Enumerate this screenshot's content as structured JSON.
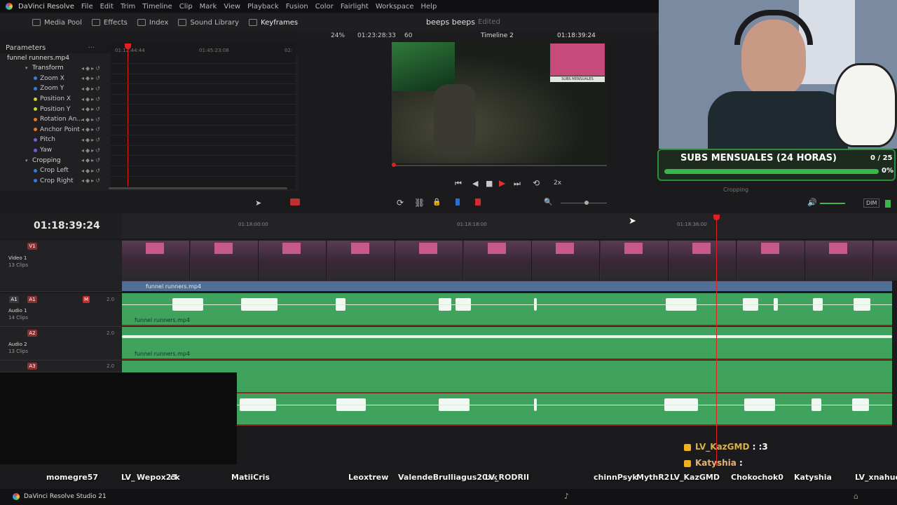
{
  "app": {
    "name": "DaVinci Resolve",
    "menu": [
      "File",
      "Edit",
      "Trim",
      "Timeline",
      "Clip",
      "Mark",
      "View",
      "Playback",
      "Fusion",
      "Color",
      "Fairlight",
      "Workspace",
      "Help"
    ]
  },
  "toolbar": {
    "media_pool": "Media Pool",
    "effects": "Effects",
    "index": "Index",
    "sound_library": "Sound Library",
    "keyframes": "Keyframes",
    "project_title": "beeps beeps",
    "edited": "Edited"
  },
  "viewer": {
    "zoom": "24%",
    "source_timecode": "01:23:28:33",
    "fps": "60",
    "timeline_name": "Timeline 2",
    "record_timecode": "01:18:39:24",
    "speed": "2x"
  },
  "inspector": {
    "header": "Parameters",
    "clip_name": "funnel runners.mp4",
    "ruler_left": "01:12:44:44",
    "ruler_mid": "01:45:23:08",
    "ruler_right": "02:",
    "groups": [
      {
        "label": "Transform",
        "group": true,
        "color": ""
      },
      {
        "label": "Zoom X",
        "group": false,
        "color": "#3a7bd5"
      },
      {
        "label": "Zoom Y",
        "group": false,
        "color": "#3a7bd5"
      },
      {
        "label": "Position X",
        "group": false,
        "color": "#c8d430"
      },
      {
        "label": "Position Y",
        "group": false,
        "color": "#c8d430"
      },
      {
        "label": "Rotation An...",
        "group": false,
        "color": "#e07a20"
      },
      {
        "label": "Anchor Point",
        "group": false,
        "color": "#e07a20"
      },
      {
        "label": "Pitch",
        "group": false,
        "color": "#7a5ad5"
      },
      {
        "label": "Yaw",
        "group": false,
        "color": "#7a5ad5"
      },
      {
        "label": "Cropping",
        "group": true,
        "color": ""
      },
      {
        "label": "Crop Left",
        "group": false,
        "color": "#3a7bd5"
      },
      {
        "label": "Crop Right",
        "group": false,
        "color": "#3a7bd5"
      }
    ]
  },
  "timeline": {
    "timecode": "01:18:39:24",
    "ruler_marks": [
      "01:18:00:00",
      "01:18:18:00",
      "01:18:36:00"
    ],
    "dim_label": "DIM",
    "tracks": {
      "v1": {
        "badge": "V1",
        "name": "Video 1",
        "clips": "13 Clips",
        "clip_label": "funnel runners.mp4"
      },
      "a1": {
        "badge_a": "A1",
        "badge_b": "A1",
        "name": "Audio 1",
        "clips": "14 Clips",
        "level": "2.0",
        "clip_label": "funnel runners.mp4"
      },
      "a2": {
        "badge": "A2",
        "name": "Audio 2",
        "clips": "13 Clips",
        "level": "2.0",
        "clip_label": "funnel runners.mp4"
      },
      "a3": {
        "badge": "A3",
        "level": "2.0"
      }
    },
    "ghost_label": "Cropping"
  },
  "overlay": {
    "subs_title": "SUBS MENSUALES (24 HORAS)",
    "subs_count": "0 / 25",
    "subs_percent": "0%",
    "subs_progress": 0,
    "video_caption": "SUBS MENSUALES",
    "chat": [
      {
        "user": "LV_KazGMD",
        "text": ": :3"
      },
      {
        "user": "Katyshia",
        "text": ":"
      }
    ],
    "names": [
      "momegre57",
      "LV_",
      "Wepox23",
      "ck",
      "MatiiCris",
      "Leoxtrew",
      "ValendeBrulliagus20xx",
      "LV_RODRII",
      "chinnPsyk",
      "MythR2",
      "LV_KazGMD",
      "Chokochok0",
      "Katyshia",
      "LV_xnahuel"
    ]
  },
  "taskbar": {
    "app_label": "DaVinci Resolve Studio 21"
  }
}
